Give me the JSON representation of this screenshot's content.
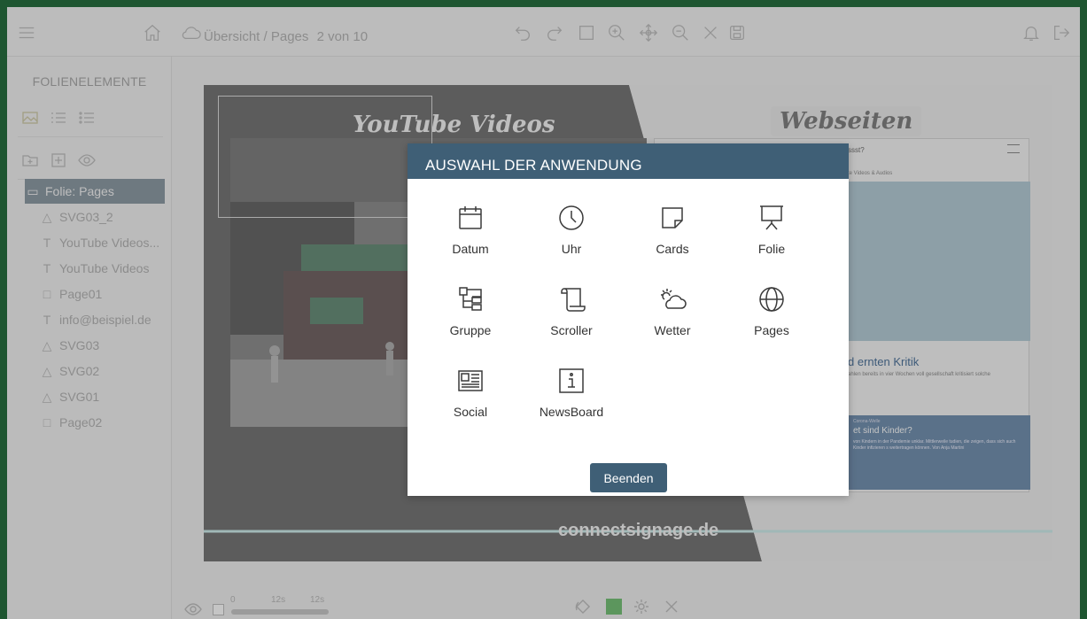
{
  "topbar": {
    "breadcrumb": "Übersicht / Pages",
    "page_counter": "2 von 10",
    "icons": [
      "menu-icon",
      "home-icon",
      "cloud-icon",
      "undo-icon",
      "redo-icon",
      "square-icon",
      "zoom-in-icon",
      "move-icon",
      "zoom-out-icon",
      "close-icon",
      "save-icon",
      "bell-icon",
      "logout-icon"
    ]
  },
  "sidebar": {
    "title": "FOLIENELEMENTE",
    "tree": [
      {
        "label": "Folie: Pages",
        "icon": "folder-icon",
        "selected": true
      },
      {
        "label": "SVG03_2",
        "icon": "triangle-icon"
      },
      {
        "label": "YouTube Videos...",
        "icon": "text-icon"
      },
      {
        "label": "YouTube Videos",
        "icon": "text-icon"
      },
      {
        "label": "Page01",
        "icon": "square-icon"
      },
      {
        "label": "info@beispiel.de",
        "icon": "text-icon"
      },
      {
        "label": "SVG03",
        "icon": "triangle-icon"
      },
      {
        "label": "SVG02",
        "icon": "triangle-icon"
      },
      {
        "label": "SVG01",
        "icon": "triangle-icon"
      },
      {
        "label": "Page02",
        "icon": "square-icon"
      }
    ]
  },
  "slide": {
    "youtube_title": "YouTube Videos",
    "web_title": "Webseiten",
    "domain": "connectsignage.de",
    "web_headline": "d ernten Kritik",
    "web_text": "ahlen bereits in vier Wochen voll gesellschaft kritisiert solche",
    "web_box_tag": "Corona-Welle",
    "web_box_title": "et sind Kinder?",
    "web_box_text": "von Kindern in der Pandemie unklar. Mittlerweile tudien, die zeigen, dass sich auch Kinder infizieren s weitertragen können. Von Anja Martini",
    "web_nav": "ssst?",
    "web_tabs": "te   Videos & Audios"
  },
  "bottombar": {
    "timeline_start": "0",
    "timeline_mid": "12s",
    "timeline_end": "12s",
    "status_color": "#5fb760"
  },
  "modal": {
    "title": "AUSWAHL DER ANWENDUNG",
    "apps": [
      {
        "label": "Datum",
        "icon": "calendar-icon"
      },
      {
        "label": "Uhr",
        "icon": "clock-icon"
      },
      {
        "label": "Cards",
        "icon": "card-icon"
      },
      {
        "label": "Folie",
        "icon": "presentation-icon"
      },
      {
        "label": "Gruppe",
        "icon": "group-icon"
      },
      {
        "label": "Scroller",
        "icon": "scroll-icon"
      },
      {
        "label": "Wetter",
        "icon": "weather-icon"
      },
      {
        "label": "Pages",
        "icon": "globe-icon"
      },
      {
        "label": "Social",
        "icon": "newspaper-icon"
      },
      {
        "label": "NewsBoard",
        "icon": "info-icon"
      }
    ],
    "close_label": "Beenden"
  },
  "colors": {
    "frame": "#1e5631",
    "accent": "#3f5f76",
    "selected": "#7a8a96"
  }
}
